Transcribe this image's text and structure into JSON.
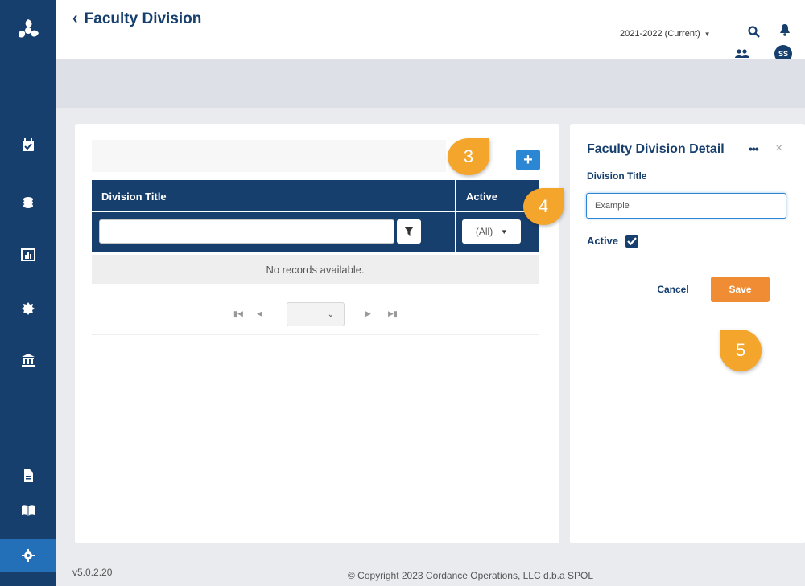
{
  "header": {
    "back_label": "Faculty Division",
    "year_selector": "2021-2022 (Current)",
    "avatar_initials": "SS"
  },
  "grid": {
    "columns": [
      "Division Title",
      "Active"
    ],
    "active_filter_value": "(All)",
    "empty_message": "No records available."
  },
  "detail": {
    "title": "Faculty Division Detail",
    "more_label": "•••",
    "close_label": "×",
    "division_title_label": "Division Title",
    "division_title_value": "Example",
    "active_label": "Active",
    "active_checked": true,
    "cancel_label": "Cancel",
    "save_label": "Save"
  },
  "markers": {
    "m3": "3",
    "m4": "4",
    "m5": "5"
  },
  "footer": {
    "version": "v5.0.2.20",
    "copyright": "© Copyright 2023 Cordance Operations, LLC d.b.a SPOL"
  },
  "colors": {
    "navy": "#173f6e",
    "accent_blue": "#2b86d3",
    "save_orange": "#f08c33",
    "marker_yellow": "#f3a52c"
  }
}
